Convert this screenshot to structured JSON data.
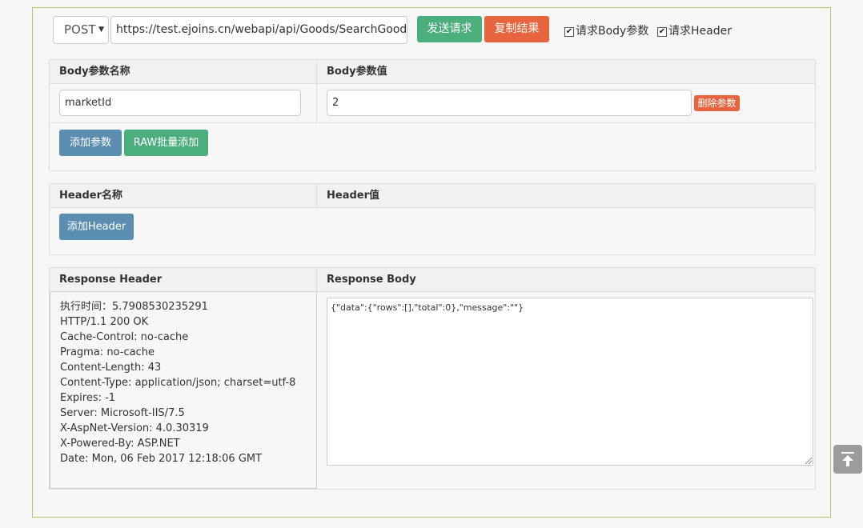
{
  "toolbar": {
    "method": "POST",
    "url": "https://test.ejoins.cn/webapi/api/Goods/SearchGoodsL",
    "send_label": "发送请求",
    "copy_label": "复制结果",
    "check_body_label": "请求Body参数",
    "check_header_label": "请求Header",
    "check_body_checked": true,
    "check_header_checked": true
  },
  "body_params": {
    "name_header": "Body参数名称",
    "value_header": "Body参数值",
    "rows": [
      {
        "name": "marketId",
        "value": "2",
        "delete_label": "删除参数"
      }
    ],
    "add_label": "添加参数",
    "raw_label": "RAW批量添加"
  },
  "headers": {
    "name_header": "Header名称",
    "value_header": "Header值",
    "add_label": "添加Header"
  },
  "response": {
    "header_title": "Response Header",
    "body_title": "Response Body",
    "header_lines": [
      "执行时间：5.7908530235291",
      "HTTP/1.1 200 OK",
      "Cache-Control: no-cache",
      "Pragma: no-cache",
      "Content-Length: 43",
      "Content-Type: application/json; charset=utf-8",
      "Expires: -1",
      "Server: Microsoft-IIS/7.5",
      "X-AspNet-Version: 4.0.30319",
      "X-Powered-By: ASP.NET",
      "Date: Mon, 06 Feb 2017 12:18:06 GMT"
    ],
    "body_text": "{\"data\":{\"rows\":[],\"total\":0},\"message\":\"\"}"
  },
  "icons": {
    "method_caret": "▼",
    "check_mark": "✔",
    "back_to_top": "arrow-up-to-line-icon"
  }
}
